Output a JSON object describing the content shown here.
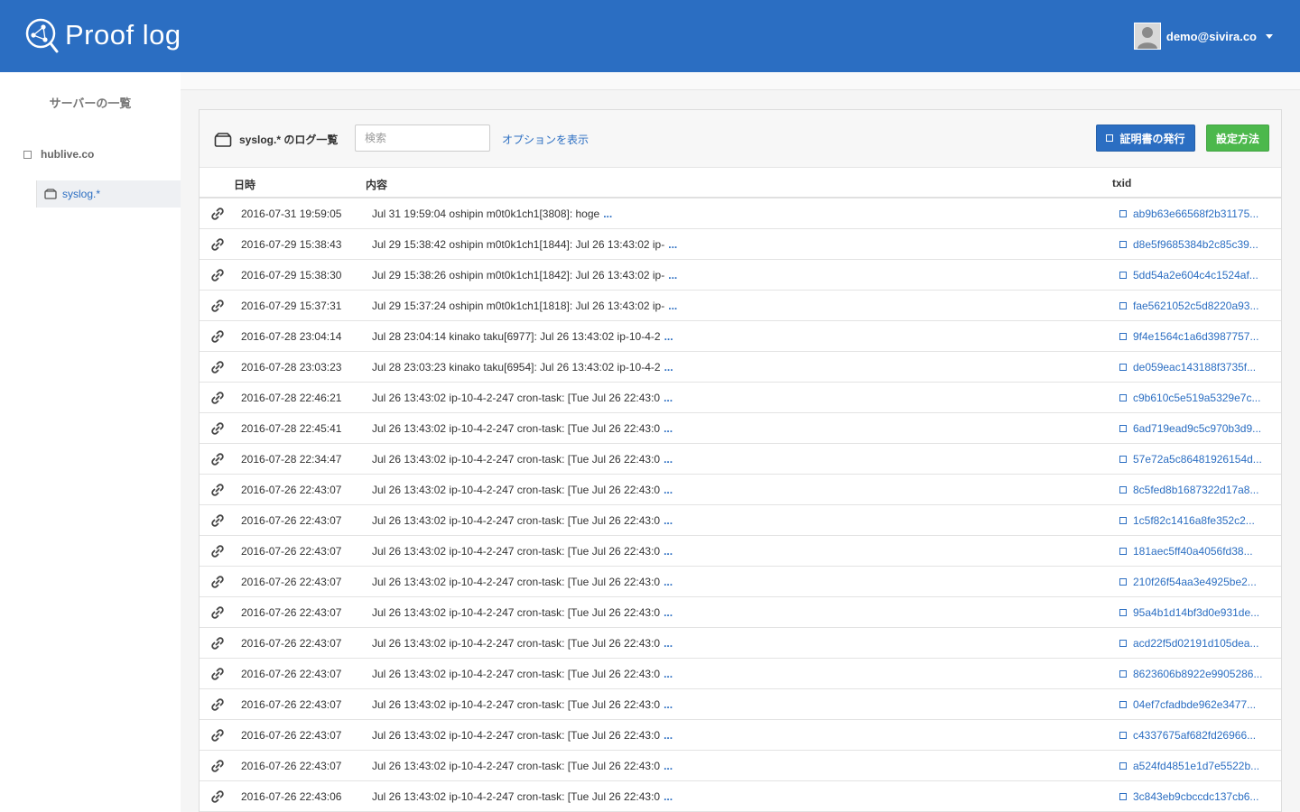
{
  "header": {
    "brand": "Proof log",
    "user_email": "demo@sivira.co"
  },
  "sidebar": {
    "title": "サーバーの一覧",
    "server": "hublive.co",
    "log": "syslog.*"
  },
  "panel": {
    "title": "syslog.* のログ一覧",
    "search_placeholder": "検索",
    "options_link": "オプションを表示",
    "cert_button": "証明書の発行",
    "setup_button": "設定方法"
  },
  "table": {
    "columns": {
      "date": "日時",
      "content": "内容",
      "txid": "txid"
    },
    "more_label": "...",
    "rows": [
      {
        "date": "2016-07-31 19:59:05",
        "content": "Jul 31 19:59:04 oshipin m0t0k1ch1[3808]: hoge",
        "txid": "ab9b63e66568f2b31175..."
      },
      {
        "date": "2016-07-29 15:38:43",
        "content": "Jul 29 15:38:42 oshipin m0t0k1ch1[1844]: Jul 26 13:43:02 ip-",
        "txid": "d8e5f9685384b2c85c39..."
      },
      {
        "date": "2016-07-29 15:38:30",
        "content": "Jul 29 15:38:26 oshipin m0t0k1ch1[1842]: Jul 26 13:43:02 ip-",
        "txid": "5dd54a2e604c4c1524af..."
      },
      {
        "date": "2016-07-29 15:37:31",
        "content": "Jul 29 15:37:24 oshipin m0t0k1ch1[1818]: Jul 26 13:43:02 ip-",
        "txid": "fae5621052c5d8220a93..."
      },
      {
        "date": "2016-07-28 23:04:14",
        "content": "Jul 28 23:04:14 kinako taku[6977]: Jul 26 13:43:02 ip-10-4-2",
        "txid": "9f4e1564c1a6d3987757..."
      },
      {
        "date": "2016-07-28 23:03:23",
        "content": "Jul 28 23:03:23 kinako taku[6954]: Jul 26 13:43:02 ip-10-4-2",
        "txid": "de059eac143188f3735f..."
      },
      {
        "date": "2016-07-28 22:46:21",
        "content": "Jul 26 13:43:02 ip-10-4-2-247 cron-task: [Tue Jul 26 22:43:0",
        "txid": "c9b610c5e519a5329e7c..."
      },
      {
        "date": "2016-07-28 22:45:41",
        "content": "Jul 26 13:43:02 ip-10-4-2-247 cron-task: [Tue Jul 26 22:43:0",
        "txid": "6ad719ead9c5c970b3d9..."
      },
      {
        "date": "2016-07-28 22:34:47",
        "content": "Jul 26 13:43:02 ip-10-4-2-247 cron-task: [Tue Jul 26 22:43:0",
        "txid": "57e72a5c86481926154d..."
      },
      {
        "date": "2016-07-26 22:43:07",
        "content": "Jul 26 13:43:02 ip-10-4-2-247 cron-task: [Tue Jul 26 22:43:0",
        "txid": "8c5fed8b1687322d17a8..."
      },
      {
        "date": "2016-07-26 22:43:07",
        "content": "Jul 26 13:43:02 ip-10-4-2-247 cron-task: [Tue Jul 26 22:43:0",
        "txid": "1c5f82c1416a8fe352c2..."
      },
      {
        "date": "2016-07-26 22:43:07",
        "content": "Jul 26 13:43:02 ip-10-4-2-247 cron-task: [Tue Jul 26 22:43:0",
        "txid": "181aec5ff40a4056fd38..."
      },
      {
        "date": "2016-07-26 22:43:07",
        "content": "Jul 26 13:43:02 ip-10-4-2-247 cron-task: [Tue Jul 26 22:43:0",
        "txid": "210f26f54aa3e4925be2..."
      },
      {
        "date": "2016-07-26 22:43:07",
        "content": "Jul 26 13:43:02 ip-10-4-2-247 cron-task: [Tue Jul 26 22:43:0",
        "txid": "95a4b1d14bf3d0e931de..."
      },
      {
        "date": "2016-07-26 22:43:07",
        "content": "Jul 26 13:43:02 ip-10-4-2-247 cron-task: [Tue Jul 26 22:43:0",
        "txid": "acd22f5d02191d105dea..."
      },
      {
        "date": "2016-07-26 22:43:07",
        "content": "Jul 26 13:43:02 ip-10-4-2-247 cron-task: [Tue Jul 26 22:43:0",
        "txid": "8623606b8922e9905286..."
      },
      {
        "date": "2016-07-26 22:43:07",
        "content": "Jul 26 13:43:02 ip-10-4-2-247 cron-task: [Tue Jul 26 22:43:0",
        "txid": "04ef7cfadbde962e3477..."
      },
      {
        "date": "2016-07-26 22:43:07",
        "content": "Jul 26 13:43:02 ip-10-4-2-247 cron-task: [Tue Jul 26 22:43:0",
        "txid": "c4337675af682fd26966..."
      },
      {
        "date": "2016-07-26 22:43:07",
        "content": "Jul 26 13:43:02 ip-10-4-2-247 cron-task: [Tue Jul 26 22:43:0",
        "txid": "a524fd4851e1d7e5522b..."
      },
      {
        "date": "2016-07-26 22:43:06",
        "content": "Jul 26 13:43:02 ip-10-4-2-247 cron-task: [Tue Jul 26 22:43:0",
        "txid": "3c843eb9cbccdc137cb6..."
      }
    ]
  }
}
